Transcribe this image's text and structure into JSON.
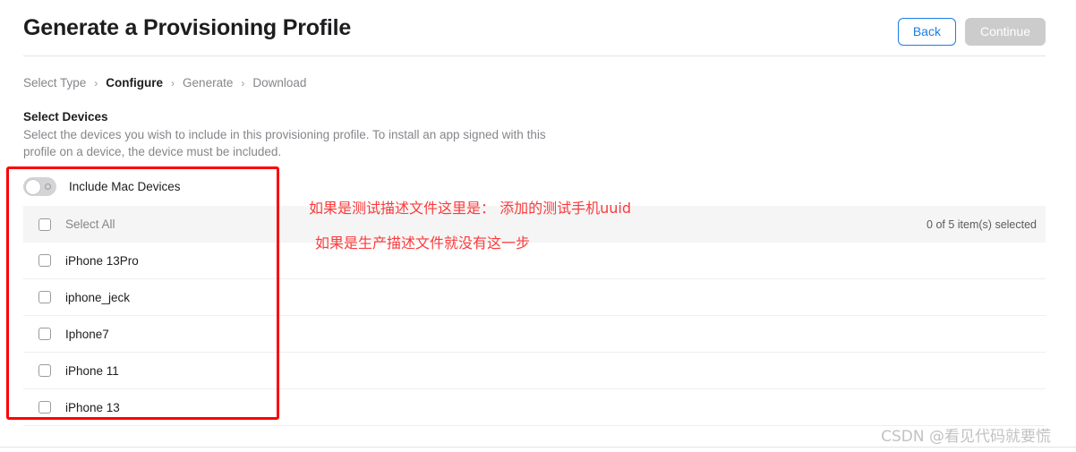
{
  "header": {
    "title": "Generate a Provisioning Profile",
    "back_label": "Back",
    "continue_label": "Continue"
  },
  "breadcrumb": {
    "separator": "›",
    "items": [
      {
        "label": "Select Type",
        "active": false
      },
      {
        "label": "Configure",
        "active": true
      },
      {
        "label": "Generate",
        "active": false
      },
      {
        "label": "Download",
        "active": false
      }
    ]
  },
  "section": {
    "title": "Select Devices",
    "description": "Select the devices you wish to include in this provisioning profile. To install an app signed with this profile on a device, the device must be included."
  },
  "mac_toggle": {
    "label": "Include Mac Devices",
    "state": "off"
  },
  "device_table": {
    "select_all_label": "Select All",
    "count_label": "0 of 5 item(s) selected",
    "rows": [
      {
        "name": "iPhone 13Pro",
        "checked": false
      },
      {
        "name": "iphone_jeck",
        "checked": false
      },
      {
        "name": "Iphone7",
        "checked": false
      },
      {
        "name": "iPhone 11",
        "checked": false
      },
      {
        "name": "iPhone 13",
        "checked": false
      }
    ]
  },
  "annotations": {
    "line1": "如果是测试描述文件这里是： 添加的测试手机uuid",
    "line2": "如果是生产描述文件就没有这一步",
    "box_color": "#fb0007",
    "text_color": "#fb3b3b"
  },
  "watermark": {
    "text": "CSDN @看见代码就要慌"
  },
  "colors": {
    "accent_blue": "#1a7ee5",
    "disabled_gray": "#cccccc",
    "head_row_bg": "#f5f5f5"
  }
}
